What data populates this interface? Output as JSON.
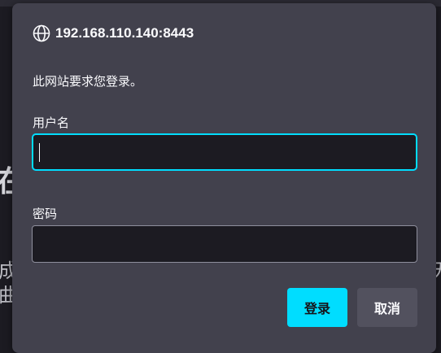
{
  "background": {
    "big_char": "在",
    "line1": "成",
    "line2": "曲",
    "right_char": "无"
  },
  "dialog": {
    "host": "192.168.110.140:8443",
    "host_icon": "globe-icon",
    "message": "此网站要求您登录。",
    "username_label": "用户名",
    "username_value": "",
    "password_label": "密码",
    "password_value": "",
    "login_button": "登录",
    "cancel_button": "取消"
  },
  "colors": {
    "accent": "#00ddff",
    "dialog_bg": "#42414d",
    "input_bg": "#1c1b22",
    "text": "#fbfbfe"
  }
}
